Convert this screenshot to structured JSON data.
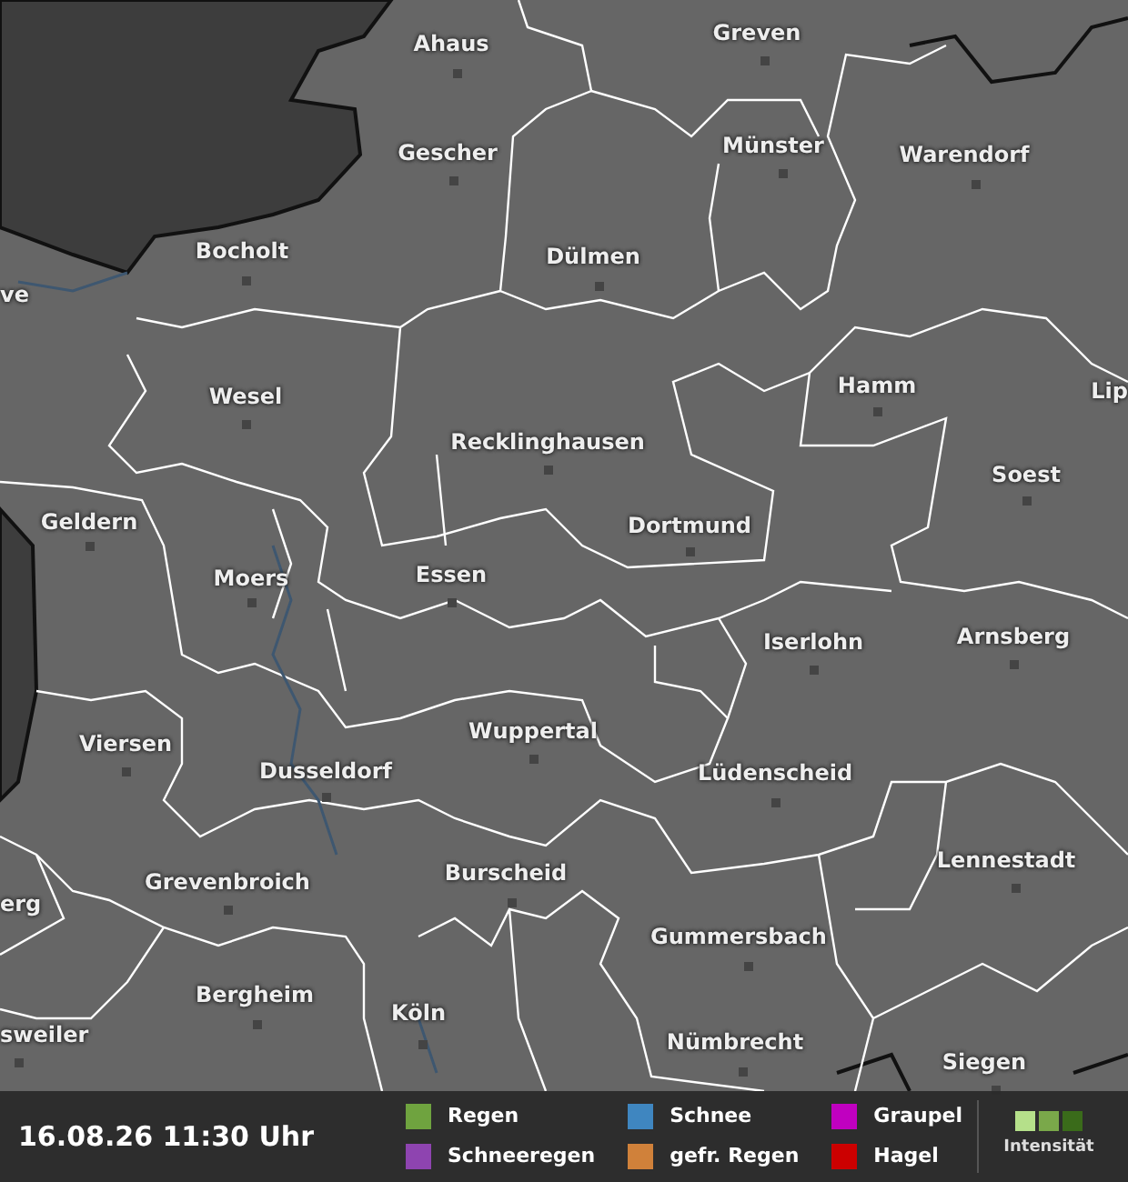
{
  "map": {
    "cities": [
      {
        "name": "Ahaus"
      },
      {
        "name": "Greven"
      },
      {
        "name": "Gescher"
      },
      {
        "name": "Münster"
      },
      {
        "name": "Warendorf"
      },
      {
        "name": "Bocholt"
      },
      {
        "name": "Dülmen"
      },
      {
        "name": "ve"
      },
      {
        "name": "Wesel"
      },
      {
        "name": "Hamm"
      },
      {
        "name": "Lip"
      },
      {
        "name": "Recklinghausen"
      },
      {
        "name": "Soest"
      },
      {
        "name": "Geldern"
      },
      {
        "name": "Dortmund"
      },
      {
        "name": "Moers"
      },
      {
        "name": "Essen"
      },
      {
        "name": "Arnsberg"
      },
      {
        "name": "Iserlohn"
      },
      {
        "name": "Wuppertal"
      },
      {
        "name": "Viersen"
      },
      {
        "name": "Dusseldorf"
      },
      {
        "name": "Lüdenscheid"
      },
      {
        "name": "Lennestadt"
      },
      {
        "name": "Burscheid"
      },
      {
        "name": "Grevenbroich"
      },
      {
        "name": "erg"
      },
      {
        "name": "Gummersbach"
      },
      {
        "name": "Bergheim"
      },
      {
        "name": "Köln"
      },
      {
        "name": "sweiler"
      },
      {
        "name": "Nümbrecht"
      },
      {
        "name": "Siegen"
      }
    ]
  },
  "footer": {
    "timestamp": "16.08.26 11:30 Uhr",
    "legend": [
      {
        "label": "Regen",
        "color": "#6fa33f"
      },
      {
        "label": "Schneeregen",
        "color": "#8e44b0"
      },
      {
        "label": "Schnee",
        "color": "#3f86c0"
      },
      {
        "label": "gefr. Regen",
        "color": "#d0813a"
      },
      {
        "label": "Graupel",
        "color": "#c000c0"
      },
      {
        "label": "Hagel",
        "color": "#cc0000"
      }
    ],
    "intensity": {
      "label": "Intensität",
      "levels": [
        {
          "color": "#b5e08a"
        },
        {
          "color": "#7aa84a"
        },
        {
          "color": "#3a6b1a"
        }
      ]
    }
  }
}
